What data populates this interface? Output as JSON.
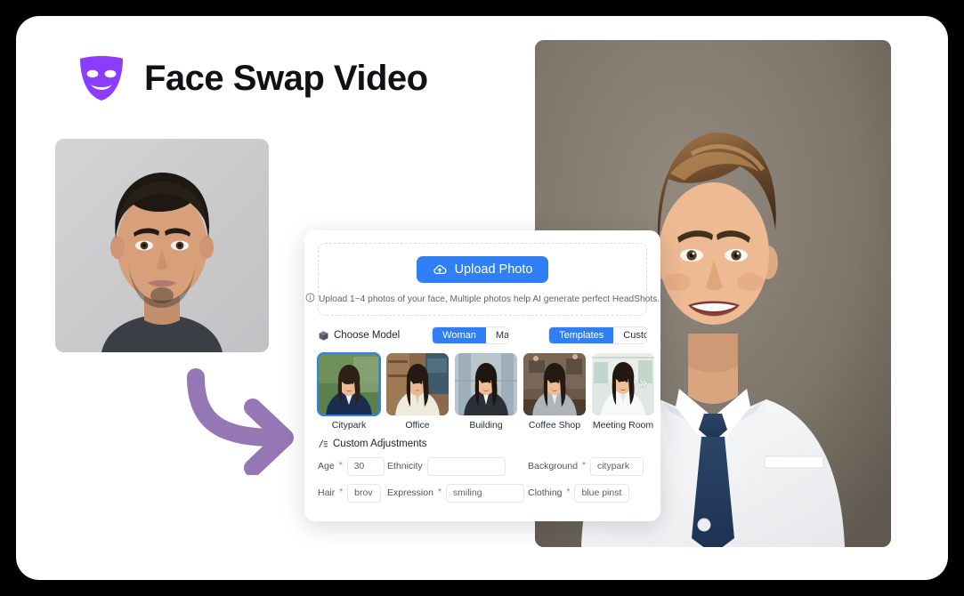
{
  "header": {
    "title": "Face Swap Video",
    "logo_icon": "theater-mask-icon",
    "logo_color": "#8B3DFF"
  },
  "media": {
    "source_photo_alt": "Source passport photo of a man on grey background",
    "result_photo_alt": "Generated headshot of smiling man in white suit with navy tie",
    "arrow_icon": "curved-right-arrow-icon",
    "arrow_color": "#9577B5"
  },
  "panel": {
    "dropzone": {
      "upload_button_label": "Upload Photo",
      "upload_icon": "cloud-upload-icon",
      "hint_icon": "info-circle-icon",
      "hint_text": "Upload 1~4 photos of your face, Multiple photos help AI generate perfect HeadShots."
    },
    "choose_model": {
      "icon": "cube-icon",
      "label": "Choose Model",
      "gender_options": [
        "Woman",
        "Man"
      ],
      "gender_selected": "Woman",
      "mode_options": [
        "Templates",
        "Custom"
      ],
      "mode_selected": "Templates"
    },
    "templates": {
      "next_icon": "double-chevron-right-icon",
      "selected": "Citypark",
      "items": [
        {
          "label": "Citypark"
        },
        {
          "label": "Office"
        },
        {
          "label": "Building"
        },
        {
          "label": "Coffee Shop"
        },
        {
          "label": "Meeting Room"
        }
      ]
    },
    "custom_adjustments": {
      "icon": "sliders-icon",
      "title": "Custom Adjustments",
      "fields": [
        {
          "label": "Age",
          "required": true,
          "value": "30",
          "placeholder": ""
        },
        {
          "label": "Ethnicity",
          "required": false,
          "value": "",
          "placeholder": ""
        },
        {
          "label": "Background",
          "required": true,
          "value": "citypark",
          "placeholder": ""
        },
        {
          "label": "Hair",
          "required": true,
          "value": "brov",
          "placeholder": ""
        },
        {
          "label": "Expression",
          "required": true,
          "value": "smiling",
          "placeholder": ""
        },
        {
          "label": "Clothing",
          "required": true,
          "value": "blue pinst",
          "placeholder": ""
        }
      ]
    }
  },
  "colors": {
    "accent_blue": "#2f80f7",
    "required_red": "#f0584b",
    "page_background": "#000000",
    "card_background": "#ffffff"
  }
}
